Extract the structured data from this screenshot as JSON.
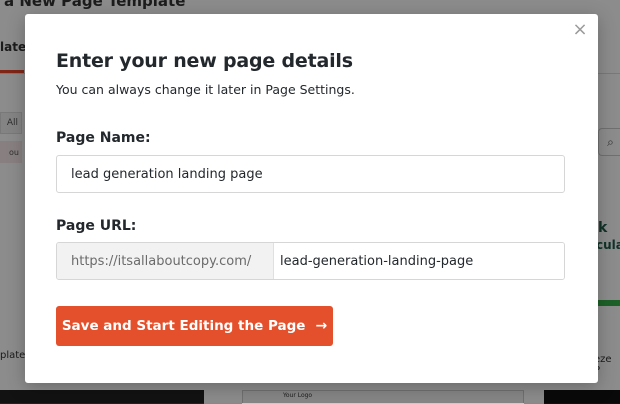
{
  "background": {
    "title": "a New Page Template",
    "tab_label": "lates",
    "filter_all": "All",
    "filter_you": "ou",
    "search_icon": "⌕",
    "card_right_k": "k",
    "card_right_cula": "cula",
    "label_left": "plate",
    "label_right": "eze P",
    "thumb_logo": "Your Logo"
  },
  "modal": {
    "close_icon": "×",
    "title": "Enter your new page details",
    "subtitle": "You can always change it later in Page Settings.",
    "page_name_label": "Page Name:",
    "page_name_value": "lead generation landing page",
    "page_url_label": "Page URL:",
    "url_prefix": "https://itsallaboutcopy.com/",
    "url_slug_value": "lead-generation-landing-page",
    "save_button_label": "Save and Start Editing the Page",
    "save_button_icon": "→"
  },
  "colors": {
    "accent": "#e4502b",
    "text": "#23282d",
    "overlay": "rgba(0,0,0,0.45)"
  }
}
